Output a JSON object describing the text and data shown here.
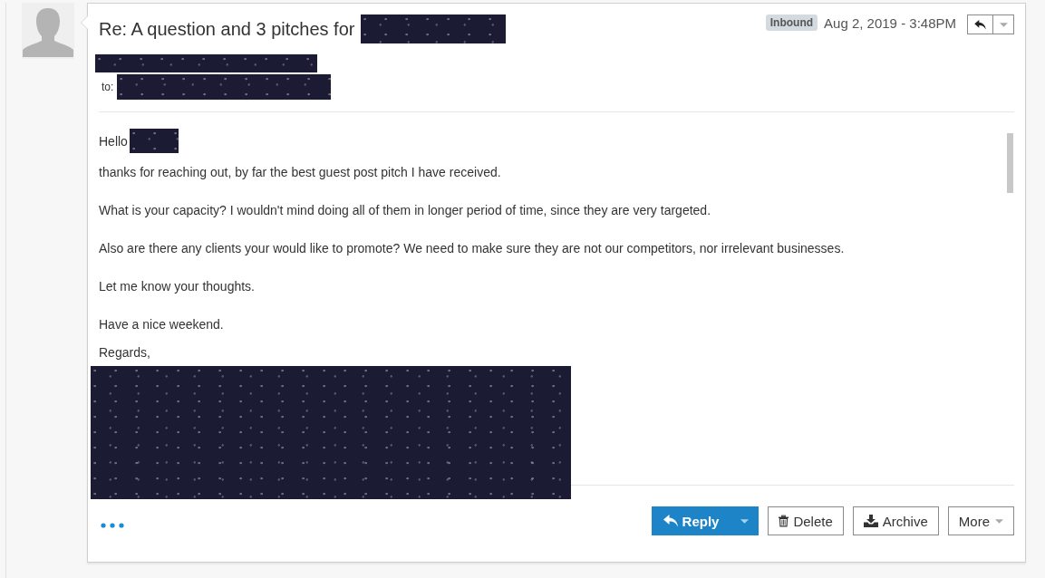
{
  "message": {
    "subject": "Re: A question and 3 pitches for",
    "badge": "Inbound",
    "date": "Aug 2, 2019 - 3:48PM",
    "recipient_label": "to:"
  },
  "body": [
    {
      "kind": "greeting",
      "text": "Hello"
    },
    {
      "kind": "line",
      "text": "thanks for reaching out, by far the best guest post pitch I have received."
    },
    {
      "kind": "paragraph",
      "text": "What is your capacity? I wouldn't mind doing all of them in longer period of time, since they are very targeted."
    },
    {
      "kind": "paragraph",
      "text": "Also are there any clients your would like to promote? We need to make sure they are not our competitors, nor irrelevant businesses."
    },
    {
      "kind": "paragraph",
      "text": "Let me know your thoughts."
    },
    {
      "kind": "paragraph",
      "text": "Have a nice weekend."
    },
    {
      "kind": "line",
      "text": "Regards,"
    }
  ],
  "actions": [
    {
      "kind": "split-primary",
      "label": "Reply"
    },
    {
      "kind": "delete",
      "label": "Delete"
    },
    {
      "kind": "archive",
      "label": "Archive"
    },
    {
      "kind": "menu",
      "label": "More"
    }
  ]
}
